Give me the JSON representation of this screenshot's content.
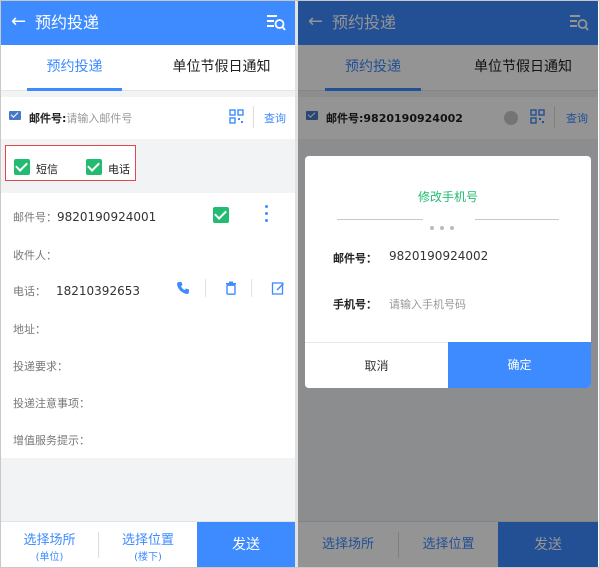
{
  "left": {
    "header": {
      "back_glyph": "←",
      "title": "预约投递",
      "menu_icon": "list-search-icon"
    },
    "tabs": [
      {
        "label": "预约投递",
        "active": true
      },
      {
        "label": "单位节假日通知",
        "active": false
      }
    ],
    "mail_search": {
      "label": "邮件号:",
      "placeholder": "请输入邮件号",
      "query_label": "查询"
    },
    "notify_options": [
      {
        "label": "短信",
        "checked": true
      },
      {
        "label": "电话",
        "checked": true
      }
    ],
    "record": {
      "mail_no_label": "邮件号：",
      "mail_no": "9820190924001",
      "recipient_label": "收件人：",
      "phone_label": "电话：",
      "phone": "18210392653",
      "address_label": "地址：",
      "requirement_label": "投递要求：",
      "notes_label": "投递注意事项：",
      "value_added_label": "增值服务提示："
    },
    "bottom": {
      "location": {
        "label": "选择场所",
        "sub": "(单位)"
      },
      "position": {
        "label": "选择位置",
        "sub": "(楼下)"
      },
      "send_label": "发送"
    }
  },
  "right": {
    "header": {
      "back_glyph": "←",
      "title": "预约投递",
      "menu_icon": "list-search-icon"
    },
    "tabs": [
      {
        "label": "预约投递",
        "active": true
      },
      {
        "label": "单位节假日通知",
        "active": false
      }
    ],
    "mail_search": {
      "label": "邮件号:",
      "value": "9820190924002",
      "query_label": "查询"
    },
    "dialog": {
      "title": "修改手机号",
      "mail_no_label": "邮件号：",
      "mail_no": "9820190924002",
      "phone_label": "手机号：",
      "phone_placeholder": "请输入手机号码",
      "cancel_label": "取消",
      "confirm_label": "确定"
    },
    "bottom": {
      "location_label": "选择场所",
      "position_label": "选择位置",
      "send_label": "发送"
    }
  },
  "colors": {
    "accent": "#3d8bff",
    "check": "#22bb6f",
    "highlight": "#e0484d"
  }
}
